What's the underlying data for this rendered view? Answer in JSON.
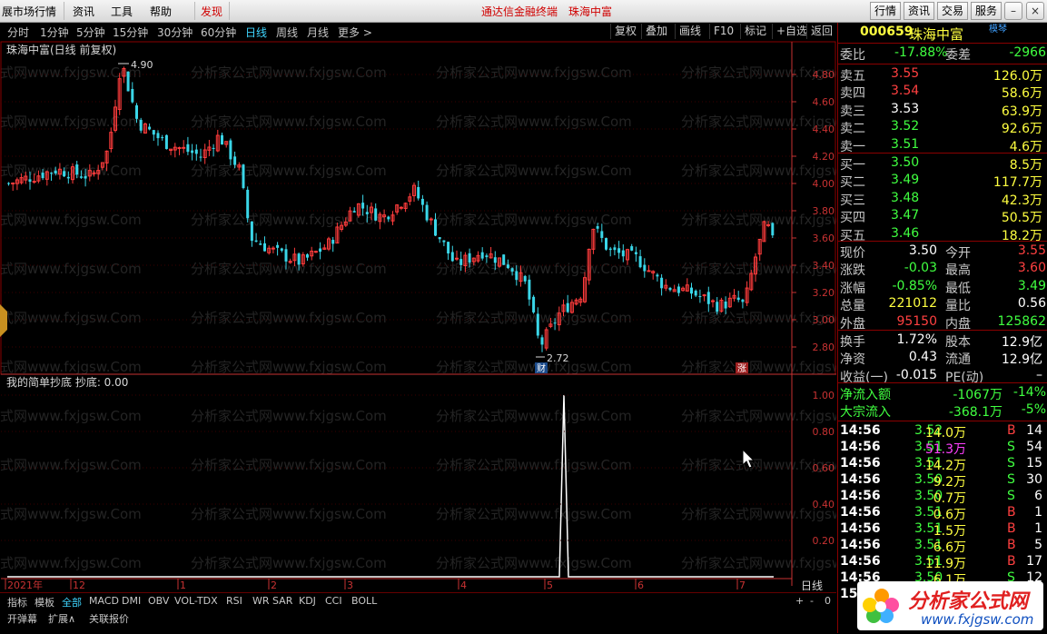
{
  "titlebar": {
    "menus": [
      "展市场行情",
      "资讯",
      "工具",
      "帮助",
      "发现"
    ],
    "center_title": "通达信金融终端",
    "center_stock": "珠海中富",
    "right_buttons": [
      "行情",
      "资讯",
      "交易",
      "服务"
    ]
  },
  "periods": {
    "items": [
      "分时",
      "1分钟",
      "5分钟",
      "15分钟",
      "30分钟",
      "60分钟",
      "日线",
      "周线",
      "月线",
      "更多 >"
    ],
    "active_index": 6
  },
  "tools": [
    "复权",
    "叠加",
    "画线",
    "F10",
    "标记",
    "+自选",
    "返回"
  ],
  "chart": {
    "main_title": "珠海中富(日线 前复权)",
    "high_label": "4.90",
    "low_label": "2.72",
    "badge_cai": "财",
    "badge_zhang": "涨",
    "y_ticks": [
      "4.80",
      "4.60",
      "4.40",
      "4.20",
      "4.00",
      "3.80",
      "3.60",
      "3.40",
      "3.20",
      "3.00",
      "2.80"
    ],
    "indicator_title": "我的简单抄底  抄底: 0.00",
    "ind_ticks": [
      "1.00",
      "0.80",
      "0.60",
      "0.40",
      "0.20"
    ],
    "x_labels": [
      "2021年",
      "12",
      "1",
      "2",
      "3",
      "4",
      "5",
      "6",
      "7"
    ],
    "period_label": "日线",
    "watermark": "分析家公式网www.fxjgsw.Com",
    "colors": {
      "up": "#ff3c3c",
      "down": "#3ad6e8",
      "grid": "#8a0000",
      "axis": "#c83232"
    }
  },
  "chart_data": {
    "type": "candlestick",
    "title": "珠海中富(日线 前复权)",
    "ylim": [
      2.72,
      4.9
    ],
    "high": 4.9,
    "low": 2.72,
    "indicator": {
      "name": "我的简单抄底",
      "value": 0.0,
      "ylim": [
        0,
        1.0
      ]
    }
  },
  "panel": {
    "code": "000659",
    "name": "珠海中富",
    "tag": "模琴",
    "weibi_label": "委比",
    "weibi": "-17.88%",
    "weicha_label": "委差",
    "weicha": "-2966",
    "asks": [
      {
        "label": "卖五",
        "price": "3.55",
        "vol": "126.0万"
      },
      {
        "label": "卖四",
        "price": "3.54",
        "vol": "58.6万"
      },
      {
        "label": "卖三",
        "price": "3.53",
        "vol": "63.9万"
      },
      {
        "label": "卖二",
        "price": "3.52",
        "vol": "92.6万"
      },
      {
        "label": "卖一",
        "price": "3.51",
        "vol": "4.6万"
      }
    ],
    "bids": [
      {
        "label": "买一",
        "price": "3.50",
        "vol": "8.5万"
      },
      {
        "label": "买二",
        "price": "3.49",
        "vol": "117.7万"
      },
      {
        "label": "买三",
        "price": "3.48",
        "vol": "42.3万"
      },
      {
        "label": "买四",
        "price": "3.47",
        "vol": "50.5万"
      },
      {
        "label": "买五",
        "price": "3.46",
        "vol": "18.2万"
      }
    ],
    "quote": [
      {
        "l1": "现价",
        "v1": "3.50",
        "l2": "今开",
        "v2": "3.55"
      },
      {
        "l1": "涨跌",
        "v1": "-0.03",
        "l2": "最高",
        "v2": "3.60"
      },
      {
        "l1": "涨幅",
        "v1": "-0.85%",
        "l2": "最低",
        "v2": "3.49"
      },
      {
        "l1": "总量",
        "v1": "221012",
        "l2": "量比",
        "v2": "0.56"
      },
      {
        "l1": "外盘",
        "v1": "95150",
        "l2": "内盘",
        "v2": "125862"
      }
    ],
    "fin": [
      {
        "l1": "换手",
        "v1": "1.72%",
        "l2": "股本",
        "v2": "12.9亿"
      },
      {
        "l1": "净资",
        "v1": "0.43",
        "l2": "流通",
        "v2": "12.9亿"
      },
      {
        "l1": "收益(一)",
        "v1": "-0.015",
        "l2": "PE(动)",
        "v2": "–"
      }
    ],
    "flow": [
      {
        "label": "净流入额",
        "v": "-1067万",
        "p": "-14%"
      },
      {
        "label": "大宗流入",
        "v": "-368.1万",
        "p": "-5%"
      }
    ],
    "ticks": [
      {
        "t": "14:56",
        "p": "3.52",
        "v": "14.0万",
        "s": "B",
        "n": "14"
      },
      {
        "t": "14:56",
        "p": "3.51",
        "v": "51.3万",
        "s": "S",
        "n": "54"
      },
      {
        "t": "14:56",
        "p": "3.51",
        "v": "14.2万",
        "s": "S",
        "n": "15"
      },
      {
        "t": "14:56",
        "p": "3.50",
        "v": "9.2万",
        "s": "S",
        "n": "30"
      },
      {
        "t": "14:56",
        "p": "3.50",
        "v": "0.7万",
        "s": "S",
        "n": "6"
      },
      {
        "t": "14:56",
        "p": "3.51",
        "v": "0.6万",
        "s": "B",
        "n": "1"
      },
      {
        "t": "14:56",
        "p": "3.51",
        "v": "1.5万",
        "s": "B",
        "n": "1"
      },
      {
        "t": "14:56",
        "p": "3.51",
        "v": "6.6万",
        "s": "B",
        "n": "5"
      },
      {
        "t": "14:56",
        "p": "3.51",
        "v": "11.9万",
        "s": "B",
        "n": "17"
      },
      {
        "t": "14:56",
        "p": "3.50",
        "v": "6.1万",
        "s": "S",
        "n": "12"
      },
      {
        "t": "15:",
        "p": "",
        "v": "",
        "s": "",
        "n": ""
      }
    ]
  },
  "bottom": {
    "tabs": [
      "指标",
      "模板",
      "全部",
      "MACD",
      "DMI",
      "OBV",
      "VOL-TDX",
      "RSI",
      "WR",
      "SAR",
      "KDJ",
      "CCI",
      "BOLL"
    ],
    "active_tab": 2,
    "tabs2": [
      "开弹幕",
      "扩展∧",
      "关联报价"
    ],
    "zoom": [
      "+",
      "-",
      "0"
    ]
  },
  "logo": {
    "title": "分析家公式网",
    "url": "www.fxjgsw.com"
  }
}
